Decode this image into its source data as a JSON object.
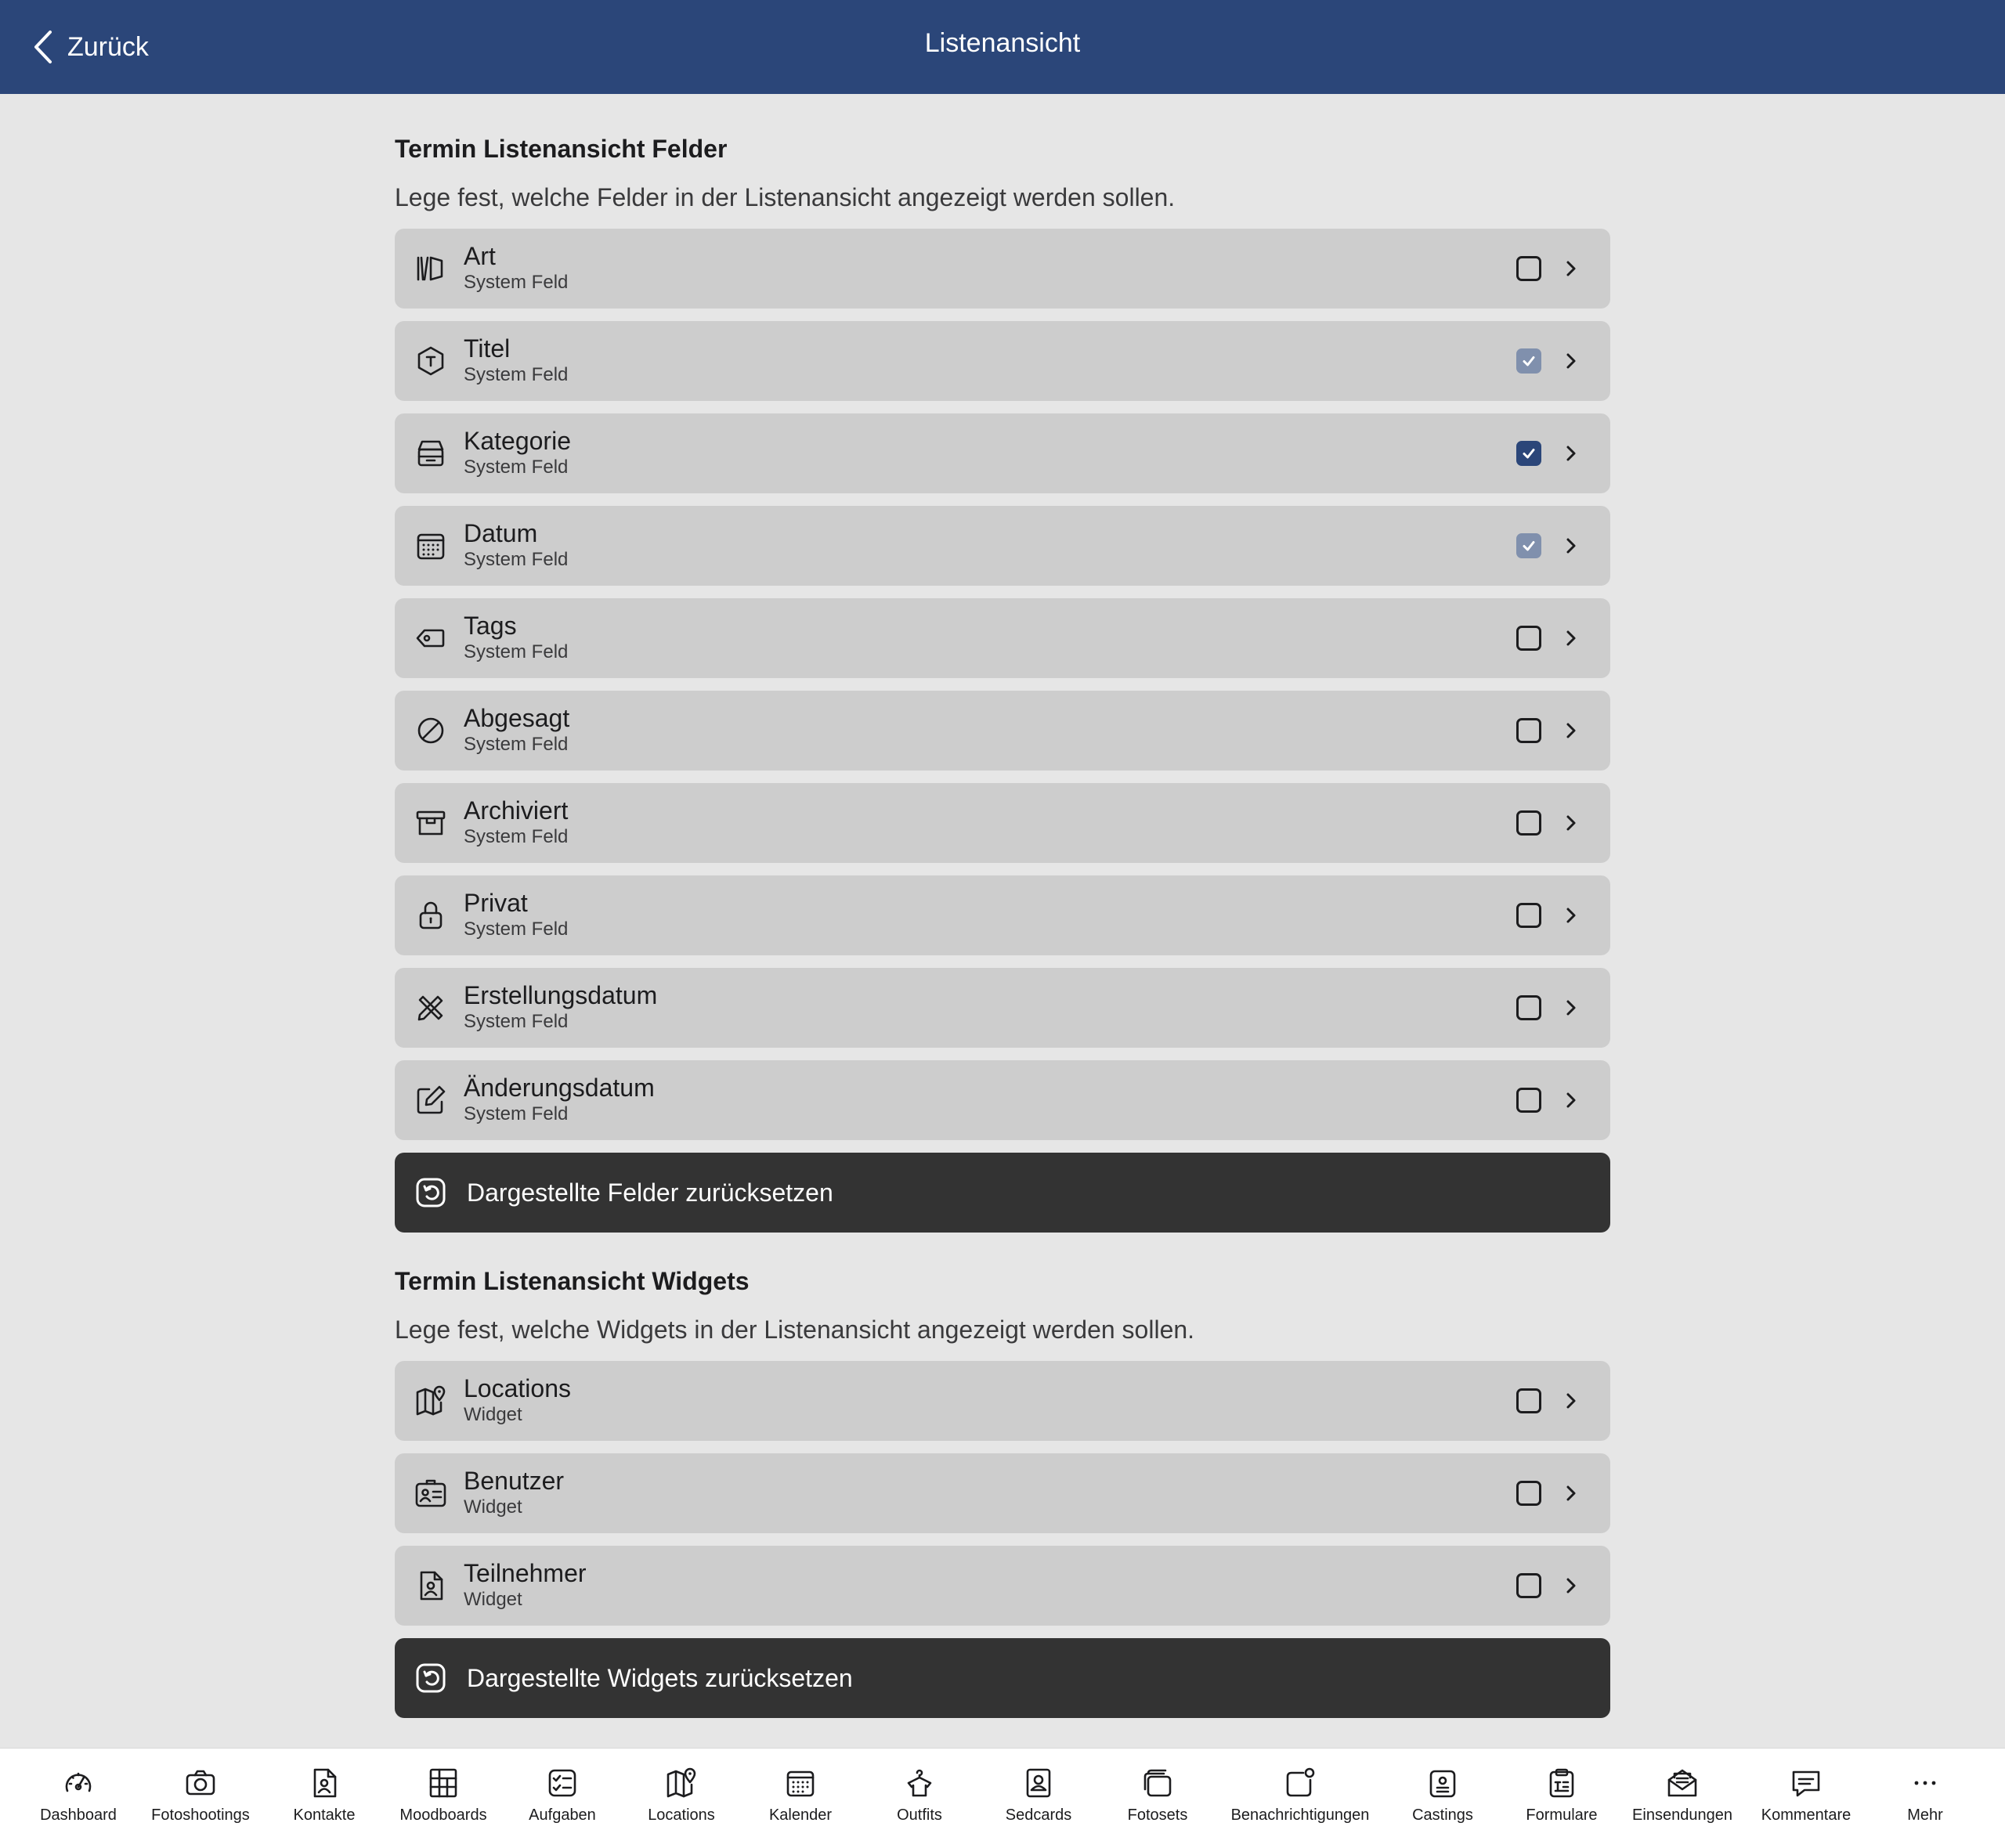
{
  "header": {
    "back_label": "Zurück",
    "title": "Listenansicht",
    "background": "#2b4679"
  },
  "fields_section": {
    "title": "Termin Listenansicht Felder",
    "description": "Lege fest, welche Felder in der Listenansicht angezeigt werden sollen.",
    "items": [
      {
        "title": "Art",
        "subtitle": "System Feld",
        "icon": "columns-icon",
        "checked": "unchecked"
      },
      {
        "title": "Titel",
        "subtitle": "System Feld",
        "icon": "hexagon-t-icon",
        "checked": "checked-light"
      },
      {
        "title": "Kategorie",
        "subtitle": "System Feld",
        "icon": "tray-icon",
        "checked": "checked-dark"
      },
      {
        "title": "Datum",
        "subtitle": "System Feld",
        "icon": "calendar-icon",
        "checked": "checked-light"
      },
      {
        "title": "Tags",
        "subtitle": "System Feld",
        "icon": "tag-icon",
        "checked": "unchecked"
      },
      {
        "title": "Abgesagt",
        "subtitle": "System Feld",
        "icon": "prohibited-icon",
        "checked": "unchecked"
      },
      {
        "title": "Archiviert",
        "subtitle": "System Feld",
        "icon": "archive-box-icon",
        "checked": "unchecked"
      },
      {
        "title": "Privat",
        "subtitle": "System Feld",
        "icon": "lock-icon",
        "checked": "unchecked"
      },
      {
        "title": "Erstellungsdatum",
        "subtitle": "System Feld",
        "icon": "pencil-ruler-icon",
        "checked": "unchecked"
      },
      {
        "title": "Änderungsdatum",
        "subtitle": "System Feld",
        "icon": "edit-square-icon",
        "checked": "unchecked"
      }
    ],
    "reset_label": "Dargestellte Felder zurücksetzen"
  },
  "widgets_section": {
    "title": "Termin Listenansicht Widgets",
    "description": "Lege fest, welche Widgets in der Listenansicht angezeigt werden sollen.",
    "items": [
      {
        "title": "Locations",
        "subtitle": "Widget",
        "icon": "map-pin-icon",
        "checked": "unchecked"
      },
      {
        "title": "Benutzer",
        "subtitle": "Widget",
        "icon": "id-card-icon",
        "checked": "unchecked"
      },
      {
        "title": "Teilnehmer",
        "subtitle": "Widget",
        "icon": "contact-file-icon",
        "checked": "unchecked"
      }
    ],
    "reset_label": "Dargestellte Widgets zurücksetzen"
  },
  "tabbar": {
    "items": [
      {
        "label": "Dashboard",
        "icon": "gauge-icon"
      },
      {
        "label": "Fotoshootings",
        "icon": "camera-icon"
      },
      {
        "label": "Kontakte",
        "icon": "contact-file-icon"
      },
      {
        "label": "Moodboards",
        "icon": "grid-icon"
      },
      {
        "label": "Aufgaben",
        "icon": "checklist-icon"
      },
      {
        "label": "Locations",
        "icon": "map-pin-icon"
      },
      {
        "label": "Kalender",
        "icon": "calendar-icon"
      },
      {
        "label": "Outfits",
        "icon": "shirt-hanger-icon"
      },
      {
        "label": "Sedcards",
        "icon": "portrait-card-icon"
      },
      {
        "label": "Fotosets",
        "icon": "stacked-cards-icon"
      },
      {
        "label": "Benachrichtigungen",
        "icon": "notification-badge-icon"
      },
      {
        "label": "Castings",
        "icon": "id-badge-icon"
      },
      {
        "label": "Formulare",
        "icon": "clipboard-icon"
      },
      {
        "label": "Einsendungen",
        "icon": "mail-open-icon"
      },
      {
        "label": "Kommentare",
        "icon": "comment-icon"
      },
      {
        "label": "Mehr",
        "icon": "more-dots-icon"
      }
    ]
  },
  "colors": {
    "background": "#e6e6e6",
    "row_background": "#cdcdcd",
    "button_background": "#333333",
    "checked_dark": "#2b4679",
    "checked_light": "#8090ad"
  }
}
